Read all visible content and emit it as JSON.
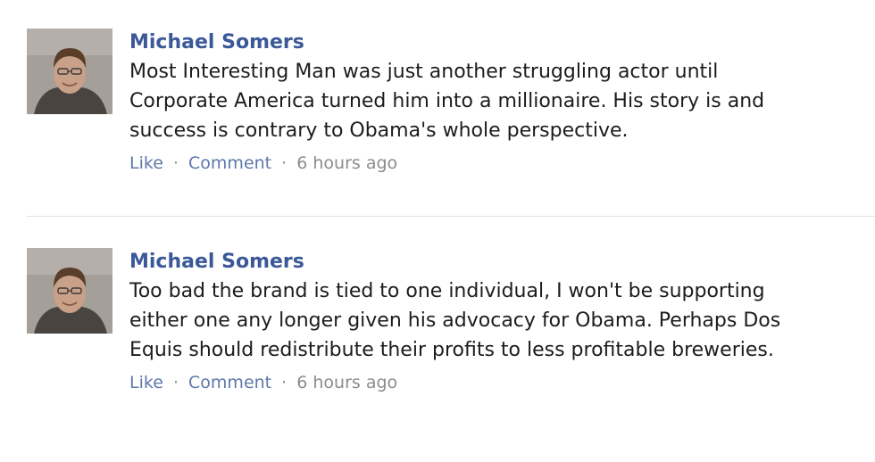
{
  "comments": [
    {
      "author": "Michael Somers",
      "text": "Most Interesting Man was just another struggling actor until Corporate America turned him into a millionaire. His story is and success is contrary to Obama's whole perspective.",
      "like_label": "Like",
      "comment_label": "Comment",
      "separator": "·",
      "timestamp": "6 hours ago"
    },
    {
      "author": "Michael Somers",
      "text": "Too bad the brand is tied to one individual, I won't be supporting either one any longer given his advocacy for Obama. Perhaps Dos Equis should redistribute their profits to less profitable breweries.",
      "like_label": "Like",
      "comment_label": "Comment",
      "separator": "·",
      "timestamp": "6 hours ago"
    }
  ]
}
